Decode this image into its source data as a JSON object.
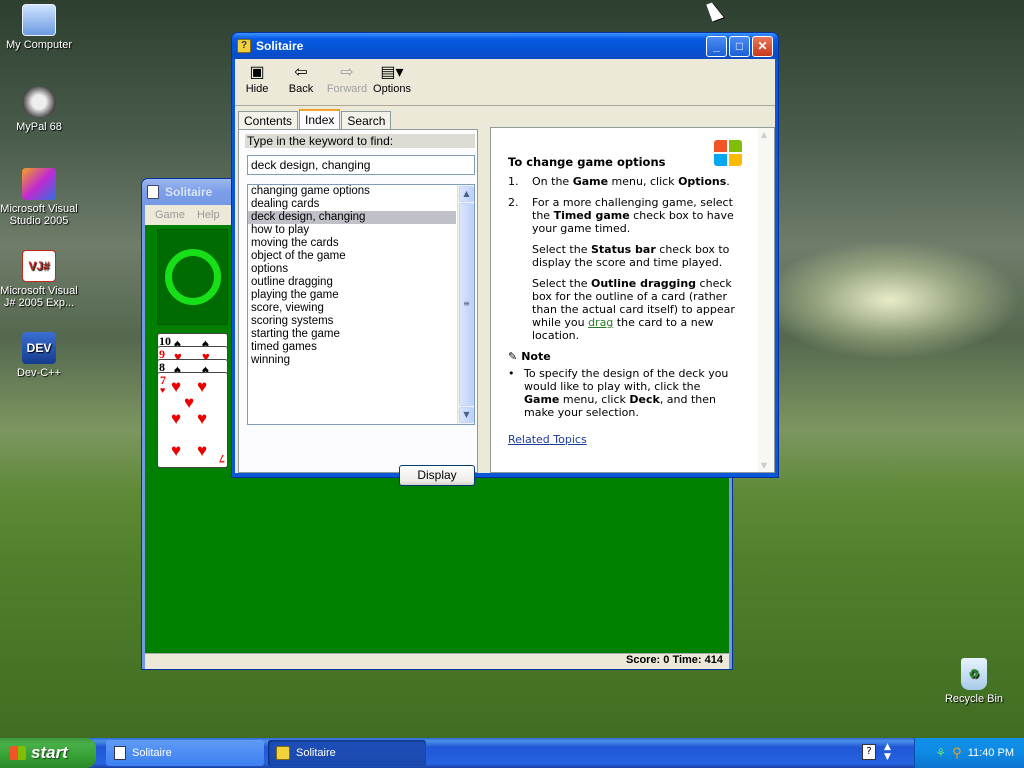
{
  "desktop": {
    "icons": [
      {
        "label": "My Computer"
      },
      {
        "label": "MyPal 68"
      },
      {
        "label": "Microsoft Visual Studio 2005"
      },
      {
        "label": "Microsoft Visual J# 2005 Exp..."
      },
      {
        "label": "Dev-C++"
      },
      {
        "label": "Recycle Bin"
      }
    ]
  },
  "solitaire_window": {
    "title": "Solitaire",
    "menu": [
      "Game",
      "Help"
    ],
    "status": "Score: 0 Time: 414",
    "cards": [
      {
        "rank": "10",
        "suit": "♠"
      },
      {
        "rank": "9",
        "suit": "♥"
      },
      {
        "rank": "8",
        "suit": "♠"
      },
      {
        "rank": "7",
        "suit": "♥"
      }
    ]
  },
  "help_window": {
    "title": "Solitaire",
    "toolbar": {
      "hide": "Hide",
      "back": "Back",
      "forward": "Forward",
      "options": "Options"
    },
    "tabs": [
      "Contents",
      "Index",
      "Search"
    ],
    "keyword_label": "Type in the keyword to find:",
    "keyword_value": "deck design, changing",
    "keywords": [
      "changing game options",
      "dealing cards",
      "deck design, changing",
      "how to play",
      "moving the cards",
      "object of the game",
      "options",
      "outline dragging",
      "playing the game",
      "score, viewing",
      "scoring systems",
      "starting the game",
      "timed games",
      "winning"
    ],
    "selected_keyword_index": 2,
    "display_button": "Display",
    "topic": {
      "heading": "To change game options",
      "step1_num": "1.",
      "step1_a": "On the ",
      "step1_b": "Game",
      "step1_c": " menu, click ",
      "step1_d": "Options",
      "step1_e": ".",
      "step2_num": "2.",
      "step2_a": "For a more challenging game, select the ",
      "step2_b": "Timed game",
      "step2_c": " check box to have your game timed.",
      "para2_a": "Select the ",
      "para2_b": "Status bar",
      "para2_c": " check box to display the score and time played.",
      "para3_a": "Select the ",
      "para3_b": "Outline dragging",
      "para3_c": " check box for the outline of a card (rather than the actual card itself) to appear while you ",
      "para3_link": "drag",
      "para3_d": " the card to a new location.",
      "note_label": "Note",
      "note_a": "To specify the design of the deck you would like to play with, click the ",
      "note_b": "Game",
      "note_c": " menu, click ",
      "note_d": "Deck",
      "note_e": ", and then make your selection.",
      "related": "Related Topics"
    }
  },
  "taskbar": {
    "start": "start",
    "tasks": [
      "Solitaire",
      "Solitaire"
    ],
    "clock": "11:40 PM"
  }
}
